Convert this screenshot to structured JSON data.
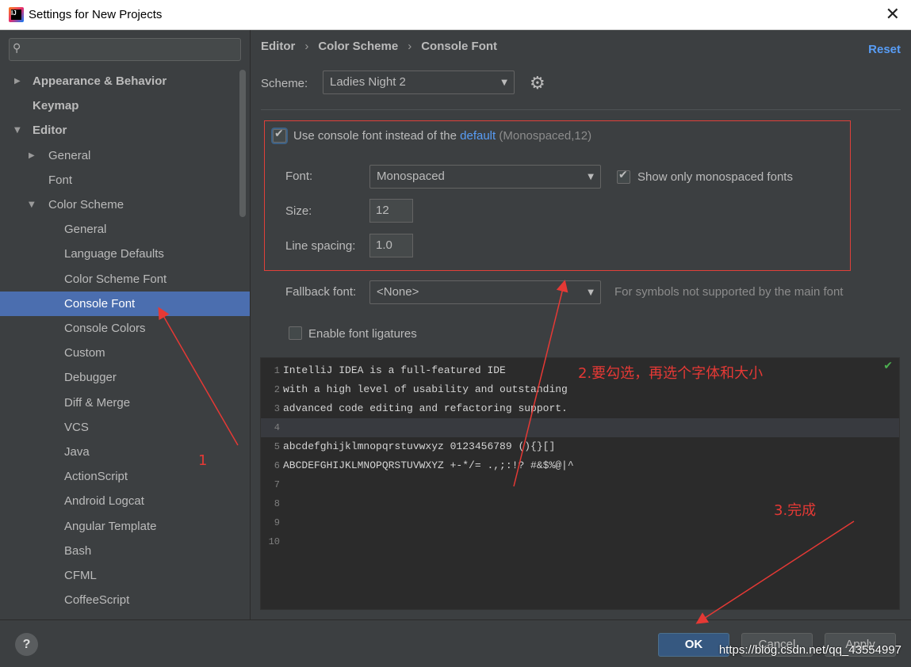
{
  "window": {
    "title": "Settings for New Projects",
    "close": "✕"
  },
  "search": {
    "placeholder": "",
    "icon": "search-icon"
  },
  "tree": [
    {
      "label": "Appearance & Behavior",
      "arrow": "▶",
      "bold": true
    },
    {
      "label": "Keymap",
      "arrow": "",
      "bold": true
    },
    {
      "label": "Editor",
      "arrow": "▼",
      "bold": true
    },
    {
      "label": "General",
      "arrow": "▶"
    },
    {
      "label": "Font",
      "arrow": ""
    },
    {
      "label": "Color Scheme",
      "arrow": "▼"
    },
    {
      "label": "General"
    },
    {
      "label": "Language Defaults"
    },
    {
      "label": "Color Scheme Font"
    },
    {
      "label": "Console Font",
      "selected": true
    },
    {
      "label": "Console Colors"
    },
    {
      "label": "Custom"
    },
    {
      "label": "Debugger"
    },
    {
      "label": "Diff & Merge"
    },
    {
      "label": "VCS"
    },
    {
      "label": "Java"
    },
    {
      "label": "ActionScript"
    },
    {
      "label": "Android Logcat"
    },
    {
      "label": "Angular Template"
    },
    {
      "label": "Bash"
    },
    {
      "label": "CFML"
    },
    {
      "label": "CoffeeScript"
    }
  ],
  "breadcrumb": {
    "items": [
      "Editor",
      "Color Scheme",
      "Console Font"
    ],
    "separator": "›"
  },
  "reset_label": "Reset",
  "scheme": {
    "label": "Scheme:",
    "value": "Ladies Night 2"
  },
  "use_console_font": {
    "checked": true,
    "prefix": "Use console font instead of the",
    "link": "default",
    "suffix": "(Monospaced,12)"
  },
  "font": {
    "label": "Font:",
    "value": "Monospaced"
  },
  "show_only_monospaced": {
    "checked": true,
    "label": "Show only monospaced fonts"
  },
  "size": {
    "label": "Size:",
    "value": "12"
  },
  "line_spacing": {
    "label": "Line spacing:",
    "value": "1.0"
  },
  "fallback": {
    "label": "Fallback font:",
    "value": "<None>",
    "hint": "For symbols not supported by the main font"
  },
  "ligatures": {
    "checked": false,
    "label": "Enable font ligatures"
  },
  "preview_lines": [
    {
      "n": "1",
      "text": "IntelliJ IDEA is a full-featured IDE"
    },
    {
      "n": "2",
      "text": "with a high level of usability and outstanding"
    },
    {
      "n": "3",
      "text": "advanced code editing and refactoring support."
    },
    {
      "n": "4",
      "text": "",
      "current": true
    },
    {
      "n": "5",
      "text": "abcdefghijklmnopqrstuvwxyz 0123456789 (){}[]"
    },
    {
      "n": "6",
      "text": "ABCDEFGHIJKLMNOPQRSTUVWXYZ +-*/= .,;:!? #&$%@|^"
    },
    {
      "n": "7",
      "text": ""
    },
    {
      "n": "8",
      "text": ""
    },
    {
      "n": "9",
      "text": ""
    },
    {
      "n": "10",
      "text": ""
    }
  ],
  "buttons": {
    "help": "?",
    "ok": "OK",
    "cancel": "Cancel",
    "apply": "Apply"
  },
  "annotations": {
    "a1": "1",
    "a2": "2.要勾选，再选个字体和大小",
    "a3": "3.完成",
    "watermark": "https://blog.csdn.net/qq_43554997"
  },
  "colors": {
    "accent": "#4b6eaf",
    "link": "#589df6",
    "annotation": "#e53935",
    "background": "#3c3f41"
  }
}
